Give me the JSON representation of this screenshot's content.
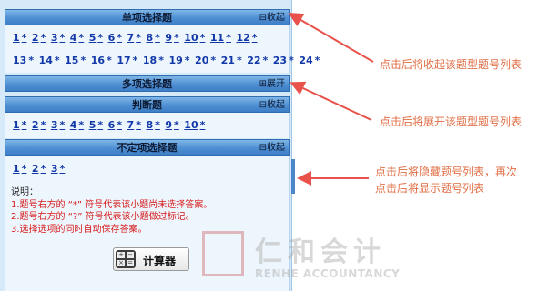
{
  "sections": [
    {
      "title": "单项选择题",
      "toggle": "⊟收起",
      "row1": [
        "1",
        "2",
        "3",
        "4",
        "5",
        "6",
        "7",
        "8",
        "9",
        "10",
        "11",
        "12"
      ],
      "row2": [
        "13",
        "14",
        "15",
        "16",
        "17",
        "18",
        "19",
        "20",
        "21",
        "22",
        "23",
        "24"
      ]
    },
    {
      "title": "多项选择题",
      "toggle": "⊞展开"
    },
    {
      "title": "判断题",
      "toggle": "⊟收起",
      "row1": [
        "1",
        "2",
        "3",
        "4",
        "5",
        "6",
        "7",
        "8",
        "9",
        "10"
      ]
    },
    {
      "title": "不定项选择题",
      "toggle": "⊟收起",
      "row1": [
        "1",
        "2",
        "3"
      ]
    }
  ],
  "unanswered_mark": "*",
  "notes": {
    "title": "说明：",
    "line1": "1.题号右方的 “*” 符号代表该小题尚未选择答案。",
    "line2": "2.题号右方的 “?” 符号代表该小题做过标记。",
    "line3": "3.选择选项的同时自动保存答案。"
  },
  "calculator": {
    "label": "计算器",
    "icon": "calculator-icon"
  },
  "annotations": {
    "a1": "点击后将收起该题型题号列表",
    "a2": "点击后将展开该题型题号列表",
    "a3_line1": "点击后将隐藏题号列表，再次",
    "a3_line2": "点击后将显示题号列表"
  },
  "watermark": {
    "cn": "仁和会计",
    "en": "RENHE ACCOUNTANCY"
  },
  "colors": {
    "accent_arrow": "#e8524a",
    "question_link": "#1238a8",
    "note_text": "#d51a1a",
    "header_blue": "#4f8fd3"
  }
}
